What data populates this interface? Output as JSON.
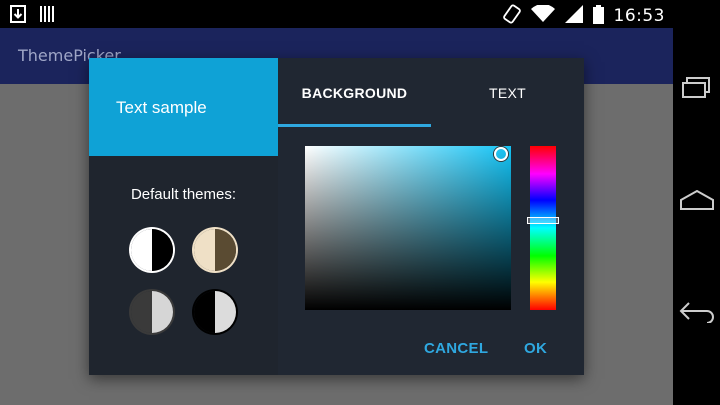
{
  "status_bar": {
    "time": "16:53",
    "icons": [
      "download-notification-icon",
      "barcode-notification-icon",
      "rotation-icon",
      "wifi-icon",
      "cell-signal-icon",
      "battery-icon"
    ]
  },
  "app": {
    "title": "ThemePicker"
  },
  "dialog": {
    "sample_text": "Text sample",
    "default_themes_label": "Default themes:",
    "themes": [
      {
        "name": "white-black-theme",
        "left": "#ffffff",
        "right": "#000000"
      },
      {
        "name": "beige-brown-theme",
        "left": "#efe0c6",
        "right": "#5a4b32"
      },
      {
        "name": "darkgray-lightgray-theme",
        "left": "#3a3a3a",
        "right": "#d6d6d6"
      },
      {
        "name": "black-lightgray-theme",
        "left": "#000000",
        "right": "#dcdcdc"
      }
    ],
    "tabs": [
      {
        "label": "BACKGROUND",
        "selected": true
      },
      {
        "label": "TEXT",
        "selected": false
      }
    ],
    "color_picker": {
      "hue_color": "#14c4f6",
      "saturation": 0.95,
      "value": 0.95,
      "hue_position": 0.45
    },
    "buttons": {
      "cancel": "CANCEL",
      "ok": "OK"
    },
    "colors": {
      "sample_bg": "#0fa2d6",
      "accent": "#2fa8e0",
      "dialog_bg": "#1f252e"
    }
  }
}
